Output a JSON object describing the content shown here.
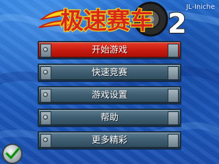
{
  "game": {
    "title_logo_text": "极速赛车",
    "title_logo_number": "2",
    "watermark": "JL-Iniche"
  },
  "menu": {
    "items": [
      {
        "label": "开始游戏",
        "selected": true
      },
      {
        "label": "快速竞赛",
        "selected": false
      },
      {
        "label": "游戏设置",
        "selected": false
      },
      {
        "label": "帮助",
        "selected": false
      },
      {
        "label": "更多精彩",
        "selected": false
      }
    ]
  },
  "softkeys": {
    "left_icon": "checkmark-icon"
  },
  "colors": {
    "background": "#1e63c4",
    "selected_button": "#c81c10",
    "button": "#3f5d70",
    "logo_text": "#d7261a",
    "logo_outline": "#f4d21a",
    "confirm_check": "#27b02a"
  }
}
